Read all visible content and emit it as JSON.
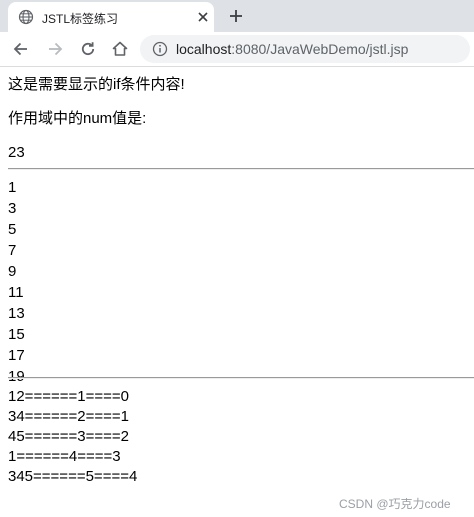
{
  "browser": {
    "tab_title": "JSTL标签练习",
    "url_host": "localhost",
    "url_path": ":8080/JavaWebDemo/jstl.jsp"
  },
  "page": {
    "if_message": "这是需要显示的if条件内容!",
    "num_label": "作用域中的num值是:",
    "num_value": "23",
    "odd_numbers": [
      "1",
      "3",
      "5",
      "7",
      "9",
      "11",
      "13",
      "15",
      "17",
      "19"
    ],
    "foreach_rows": [
      "12======1====0",
      "34======2====1",
      "45======3====2",
      "1======4====3",
      "345======5====4"
    ]
  },
  "watermark": "CSDN @巧克力code",
  "colors": {
    "tab_strip": "#dee1e6",
    "omnibox": "#f1f3f4"
  }
}
